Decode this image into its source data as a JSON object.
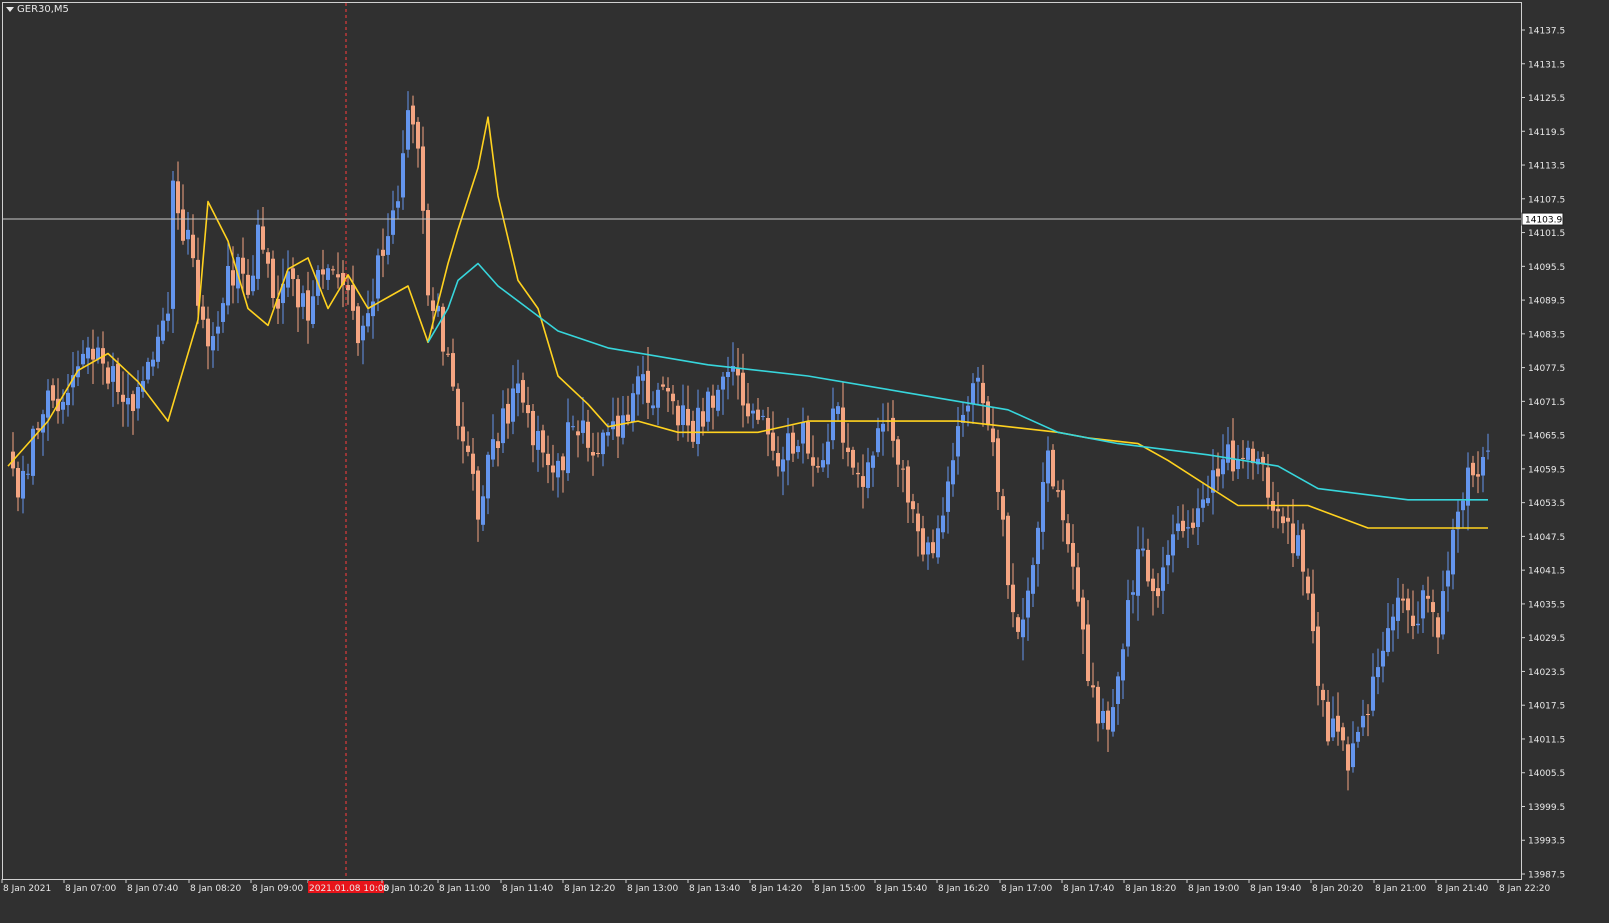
{
  "symbol_label": "GER30,M5",
  "price_axis_ticks": [
    "14137.5",
    "14131.5",
    "14125.5",
    "14119.5",
    "14113.5",
    "14107.5",
    "14101.5",
    "14095.5",
    "14089.5",
    "14083.5",
    "14077.5",
    "14071.5",
    "14065.5",
    "14059.5",
    "14053.5",
    "14047.5",
    "14041.5",
    "14035.5",
    "14029.5",
    "14023.5",
    "14017.5",
    "14011.5",
    "14005.5",
    "13999.5",
    "13993.5",
    "13987.5"
  ],
  "current_price_label": "14103.9",
  "time_axis_ticks": [
    "8 Jan 2021",
    "8 Jan 07:00",
    "8 Jan 07:40",
    "8 Jan 08:20",
    "8 Jan 09:00",
    "2021.01.08 10:00",
    "8 Jan 10:20",
    "8 Jan 11:00",
    "8 Jan 11:40",
    "8 Jan 12:20",
    "8 Jan 13:00",
    "8 Jan 13:40",
    "8 Jan 14:20",
    "8 Jan 15:00",
    "8 Jan 15:40",
    "8 Jan 16:20",
    "8 Jan 17:00",
    "8 Jan 17:40",
    "8 Jan 18:20",
    "8 Jan 19:00",
    "8 Jan 19:40",
    "8 Jan 20:20",
    "8 Jan 21:00",
    "8 Jan 21:40",
    "8 Jan 22:20"
  ],
  "colors": {
    "background": "#303030",
    "frame": "#d0d0d0",
    "text": "#e8e8e8",
    "bull_candle": "#6495ed",
    "bear_candle": "#f4a582",
    "ma_fast": "#ffd21f",
    "ma_slow": "#37d6dc",
    "crosshair_horizontal": "#c8c8c8",
    "crosshair_vertical": "#ff3b3b",
    "time_highlight_bg": "#e8141a"
  },
  "chart_data": {
    "type": "candlestick",
    "symbol": "GER30",
    "timeframe": "M5",
    "date": "2021-01-08",
    "y_range": [
      13985.0,
      14140.0
    ],
    "crosshair_price": 14103.9,
    "crosshair_time": "2021.01.08 10:00",
    "candle_count": 241,
    "candles_ohlc_sample": [
      {
        "time": "06:20",
        "open": 14062.0,
        "high": 14066.0,
        "low": 14054.0,
        "close": 14056.0
      },
      {
        "time": "07:40",
        "open": 14098.0,
        "high": 14115.0,
        "low": 14094.0,
        "close": 14108.0
      },
      {
        "time": "10:25",
        "open": 14116.0,
        "high": 14134.0,
        "low": 14114.0,
        "close": 14128.0
      },
      {
        "time": "11:00",
        "open": 14066.0,
        "high": 14068.0,
        "low": 14040.0,
        "close": 14044.0
      },
      {
        "time": "17:00",
        "open": 14072.0,
        "high": 14080.0,
        "low": 14052.0,
        "close": 14056.0
      },
      {
        "time": "18:20",
        "open": 14018.0,
        "high": 14021.0,
        "low": 14004.0,
        "close": 14010.0
      },
      {
        "time": "20:25",
        "open": 14004.0,
        "high": 14010.0,
        "low": 13992.0,
        "close": 14000.0
      },
      {
        "time": "22:25",
        "open": 14058.0,
        "high": 14066.0,
        "low": 14054.0,
        "close": 14064.0
      }
    ],
    "series": [
      {
        "color": "yellow",
        "points": [
          [
            0,
            14060
          ],
          [
            8,
            14068
          ],
          [
            14,
            14077
          ],
          [
            20,
            14080
          ],
          [
            26,
            14075
          ],
          [
            32,
            14068
          ],
          [
            38,
            14086
          ],
          [
            40,
            14107
          ],
          [
            44,
            14100
          ],
          [
            48,
            14088
          ],
          [
            52,
            14085
          ],
          [
            56,
            14095
          ],
          [
            60,
            14097
          ],
          [
            64,
            14088
          ],
          [
            68,
            14094
          ],
          [
            72,
            14088
          ],
          [
            80,
            14092
          ],
          [
            84,
            14082
          ],
          [
            86,
            14089
          ],
          [
            88,
            14096
          ],
          [
            90,
            14102
          ],
          [
            94,
            14113
          ],
          [
            96,
            14122
          ],
          [
            98,
            14108
          ],
          [
            102,
            14093
          ],
          [
            106,
            14088
          ],
          [
            110,
            14076
          ],
          [
            116,
            14071
          ],
          [
            120,
            14067
          ],
          [
            126,
            14068
          ],
          [
            134,
            14066
          ],
          [
            150,
            14066
          ],
          [
            160,
            14068
          ],
          [
            172,
            14068
          ],
          [
            190,
            14068
          ],
          [
            210,
            14066
          ],
          [
            216,
            14065
          ],
          [
            226,
            14064
          ],
          [
            232,
            14061
          ],
          [
            246,
            14053
          ],
          [
            260,
            14053
          ],
          [
            272,
            14049
          ],
          [
            296,
            14049
          ]
        ]
      },
      {
        "color": "cyan",
        "points": [
          [
            84,
            14082
          ],
          [
            88,
            14088
          ],
          [
            90,
            14093
          ],
          [
            94,
            14096
          ],
          [
            98,
            14092
          ],
          [
            104,
            14088
          ],
          [
            110,
            14084
          ],
          [
            120,
            14081
          ],
          [
            140,
            14078
          ],
          [
            160,
            14076
          ],
          [
            180,
            14073
          ],
          [
            200,
            14070
          ],
          [
            210,
            14066
          ],
          [
            222,
            14064
          ],
          [
            240,
            14062
          ],
          [
            254,
            14060
          ],
          [
            262,
            14056
          ],
          [
            280,
            14054
          ],
          [
            296,
            14054
          ]
        ]
      }
    ]
  }
}
